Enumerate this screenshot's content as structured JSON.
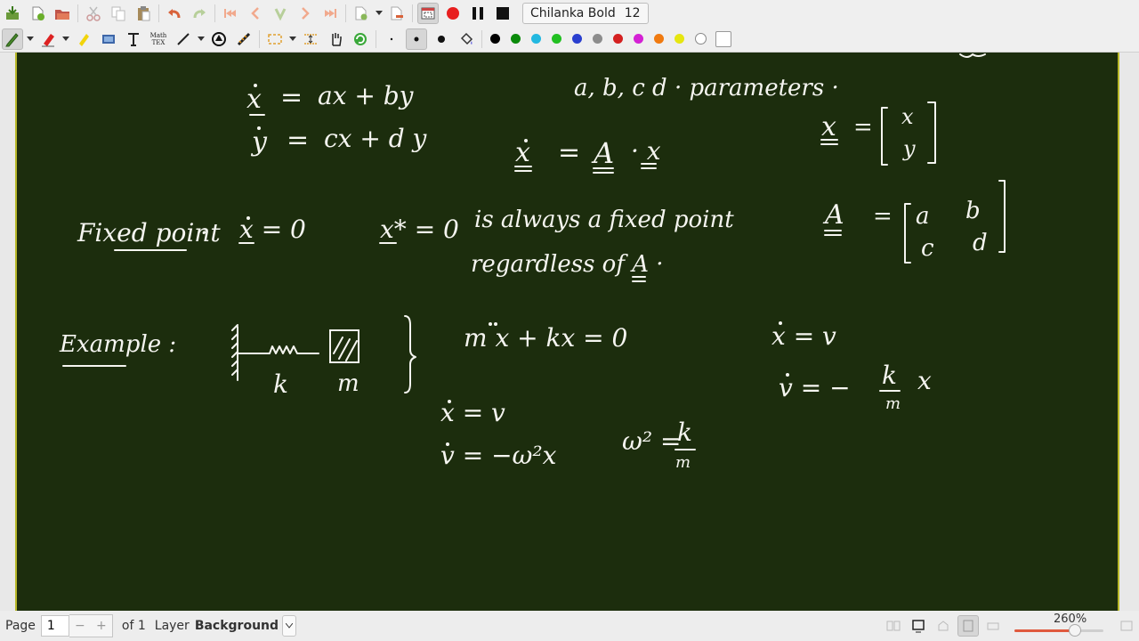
{
  "toolbar_top": {
    "font_name": "Chilanka Bold",
    "font_size": "12",
    "icons": [
      "save-icon",
      "new-page-icon",
      "open-icon",
      "cut-icon",
      "copy-icon",
      "paste-icon",
      "undo-icon",
      "redo-icon",
      "first-page-icon",
      "previous-page-icon",
      "goto-page-icon",
      "next-page-icon",
      "last-page-icon",
      "add-page-icon",
      "delete-page-icon",
      "fullscreen-icon",
      "record-icon",
      "pause-icon",
      "stop-icon"
    ]
  },
  "toolbar_tools": {
    "colors": [
      "#000000",
      "#0a8a0a",
      "#22b8e0",
      "#22c022",
      "#2a3fcf",
      "#8c8c8c",
      "#d42020",
      "#d421d4",
      "#f07a10",
      "#e6e610",
      "#ffffff",
      "#ffffff"
    ],
    "icons": [
      "pen-icon",
      "eraser-icon",
      "highlighter-icon",
      "image-icon",
      "text-icon",
      "math-tex-icon",
      "line-icon",
      "shape-recognizer-icon",
      "ruler-icon",
      "select-rect-icon",
      "vertical-space-icon",
      "hand-icon",
      "refresh-icon",
      "fine-dot-icon",
      "medium-dot-icon",
      "thick-dot-icon",
      "fill-icon"
    ],
    "math_tex_label_1": "Math",
    "math_tex_label_2": "TEX"
  },
  "canvas": {
    "background": "#1c2d0d",
    "notes": [
      "ẋ = ax + by",
      "ẏ = cx + dy",
      "a, b, c d · parameters ·",
      "ẋ = A · x",
      "x = [x y]",
      "Fixed point · ẋ = 0",
      "x* = 0 is always a fixed point regardless of A ·",
      "A = [a b; c d]",
      "Example :",
      "k",
      "m",
      "m ẍ + kx = 0",
      "ẋ = v",
      "v̇ = −ω² x",
      "ω² = k / m",
      "ẋ = v",
      "v̇ = −(k/m) x"
    ]
  },
  "statusbar": {
    "page_label": "Page",
    "page_value": "1",
    "minus": "−",
    "plus": "+",
    "of_label": "of 1",
    "layer_label": "Layer",
    "layer_value": "Background",
    "zoom_label": "260%",
    "zoom_fraction": 0.67
  }
}
